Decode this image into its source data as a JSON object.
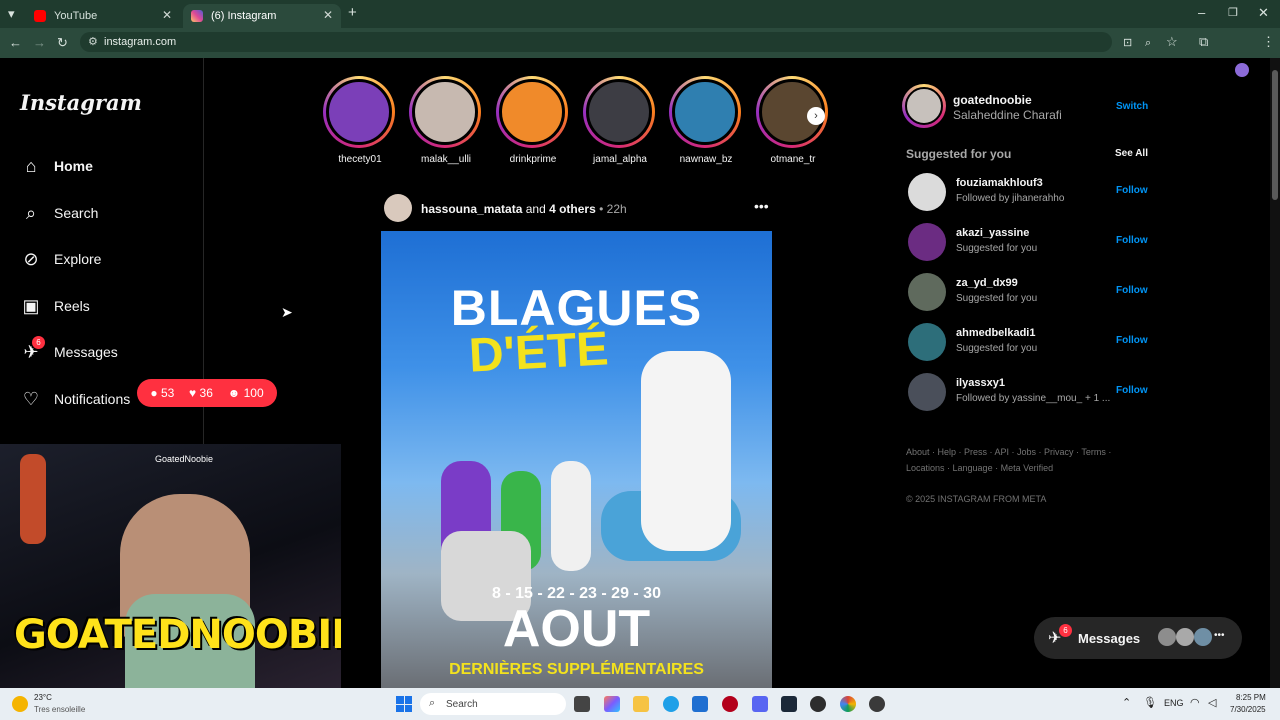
{
  "browser": {
    "tabs": [
      {
        "title": "YouTube",
        "active": false
      },
      {
        "title": "(6) Instagram",
        "active": true
      }
    ],
    "url": "instagram.com"
  },
  "instagram": {
    "logo": "Instagram",
    "nav": [
      {
        "label": "Home",
        "icon": "home-icon"
      },
      {
        "label": "Search",
        "icon": "search-icon"
      },
      {
        "label": "Explore",
        "icon": "compass-icon"
      },
      {
        "label": "Reels",
        "icon": "reels-icon"
      },
      {
        "label": "Messages",
        "icon": "messenger-icon",
        "badge": "6"
      },
      {
        "label": "Notifications",
        "icon": "heart-icon"
      }
    ],
    "notif_popup": {
      "comments": "53",
      "likes": "36",
      "follows": "100"
    },
    "stories": [
      {
        "name": "thecety01"
      },
      {
        "name": "malak__ulli"
      },
      {
        "name": "drinkprime"
      },
      {
        "name": "jamal_alpha"
      },
      {
        "name": "nawnaw_bz"
      },
      {
        "name": "otmane_tr"
      }
    ],
    "post": {
      "author": "hassouna_matata",
      "and": "and",
      "others": "4 others",
      "time": "22h",
      "image_text": {
        "line1": "BLAGUES",
        "line2": "D'ÉTÉ",
        "dates": "8 - 15 - 22 - 23 - 29 - 30",
        "month": "AOUT",
        "footer": "DERNIÈRES SUPPLÉMENTAIRES"
      }
    },
    "account": {
      "username": "goatednoobie",
      "name": "Salaheddine Charafi",
      "switch": "Switch"
    },
    "suggested": {
      "title": "Suggested for you",
      "see_all": "See All",
      "items": [
        {
          "username": "fouziamakhlouf3",
          "sub": "Followed by jihanerahho",
          "action": "Follow"
        },
        {
          "username": "akazi_yassine",
          "sub": "Suggested for you",
          "action": "Follow"
        },
        {
          "username": "za_yd_dx99",
          "sub": "Suggested for you",
          "action": "Follow"
        },
        {
          "username": "ahmedbelkadi1",
          "sub": "Suggested for you",
          "action": "Follow"
        },
        {
          "username": "ilyassxy1",
          "sub": "Followed by yassine__mou_ + 1 ...",
          "action": "Follow"
        }
      ]
    },
    "footer_links_1": "About · Help · Press · API · Jobs · Privacy · Terms ·",
    "footer_links_2": "Locations · Language · Meta Verified",
    "copyright": "© 2025 INSTAGRAM FROM META",
    "messages_pill": {
      "label": "Messages",
      "badge": "6"
    }
  },
  "webcam": {
    "overlay_text": "GOATEDNOOBIE",
    "tag": "GoatedNoobie"
  },
  "taskbar": {
    "weather_temp": "23°C",
    "weather_desc": "Tres ensoleille",
    "search_placeholder": "Search",
    "lang": "ENG",
    "time": "8:25 PM",
    "date": "7/30/2025"
  }
}
